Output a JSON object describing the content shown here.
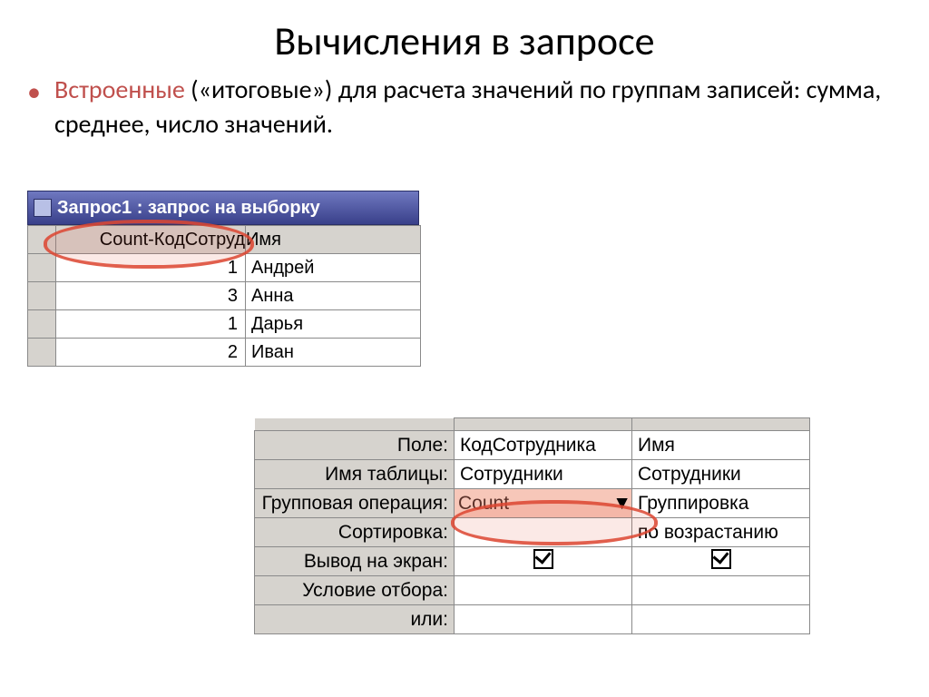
{
  "title": "Вычисления в запросе",
  "bullet": {
    "lead_word": "Встроенные",
    "rest": " («итоговые») для расчета значений по группам записей: сумма, среднее, число значений."
  },
  "window1": {
    "title": "Запрос1 : запрос на выборку",
    "columns": [
      "Count-КодСотруд",
      "Имя"
    ],
    "rows": [
      {
        "count": "1",
        "name": "Андрей"
      },
      {
        "count": "3",
        "name": "Анна"
      },
      {
        "count": "1",
        "name": "Дарья"
      },
      {
        "count": "2",
        "name": "Иван"
      }
    ]
  },
  "design": {
    "row_labels": [
      "Поле:",
      "Имя таблицы:",
      "Групповая операция:",
      "Сортировка:",
      "Вывод на экран:",
      "Условие отбора:",
      "или:"
    ],
    "col1": {
      "field": "КодСотрудника",
      "table": "Сотрудники",
      "group_op": "Count",
      "sort": "",
      "show": true,
      "criteria": "",
      "or": ""
    },
    "col2": {
      "field": "Имя",
      "table": "Сотрудники",
      "group_op": "Группировка",
      "sort": "по возрастанию",
      "show": true,
      "criteria": "",
      "or": ""
    }
  }
}
